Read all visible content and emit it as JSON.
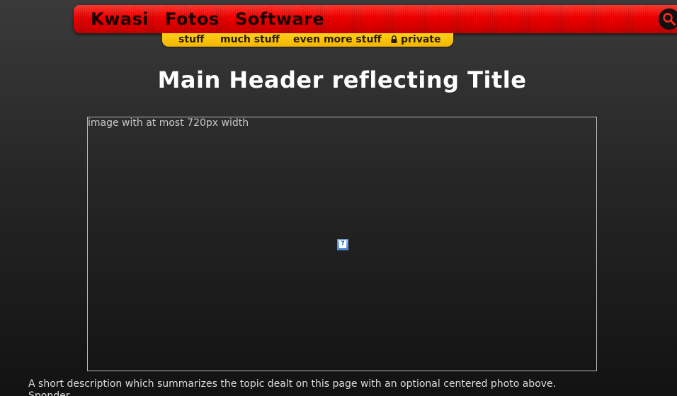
{
  "main_nav": {
    "items": [
      "Kwasi",
      "Fotos",
      "Software"
    ],
    "search_icon": "magnifier-icon",
    "bar_color": "#e80000"
  },
  "sub_nav": {
    "items": [
      "stuff",
      "much stuff",
      "even more stuff",
      "private"
    ],
    "private_icon": "lock-icon",
    "bar_color": "#f7c000"
  },
  "header": {
    "title": "Main Header reflecting Title"
  },
  "image": {
    "alt_text": "image with at most 720px width",
    "broken_image_icon": "broken-image-icon"
  },
  "description": "A short description which summarizes the topic dealt on this page with an optional centered photo above.",
  "author": "Sponder"
}
